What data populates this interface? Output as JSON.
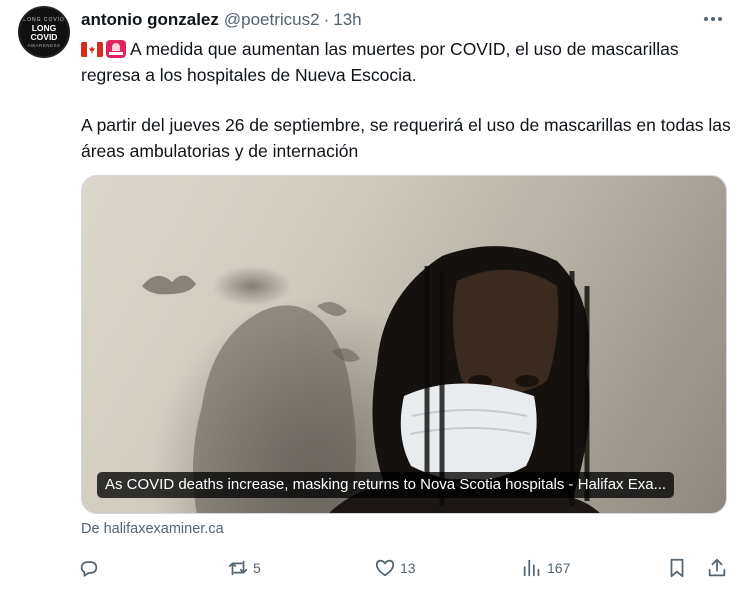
{
  "tweet": {
    "avatar": {
      "top_ring": "LONG COVID",
      "label_line1": "LONG",
      "label_line2": "COVID",
      "bottom_ring": "AWARENESS"
    },
    "author_name": "antonio gonzalez",
    "handle": "@poetricus2",
    "separator": "·",
    "time": "13h",
    "paragraph1": "A medida que aumentan las muertes por COVID, el uso de mascarillas regresa a los hospitales de Nueva Escocia.",
    "paragraph2": "A partir del jueves 26 de septiembre, se requerirá el uso de mascarillas en todas las áreas ambulatorias y de internación",
    "emojis": [
      "canada-flag",
      "rotating-light"
    ],
    "card": {
      "caption": "As COVID deaths increase, masking returns to Nova Scotia hospitals - Halifax Exa..."
    },
    "source": "De halifaxexaminer.ca",
    "stats": {
      "retweets": "5",
      "likes": "13",
      "views": "167"
    }
  },
  "colors": {
    "text": "#0f1419",
    "muted": "#536471",
    "border": "#cfd9de",
    "caption_bg": "rgba(0,0,0,0.77)"
  }
}
